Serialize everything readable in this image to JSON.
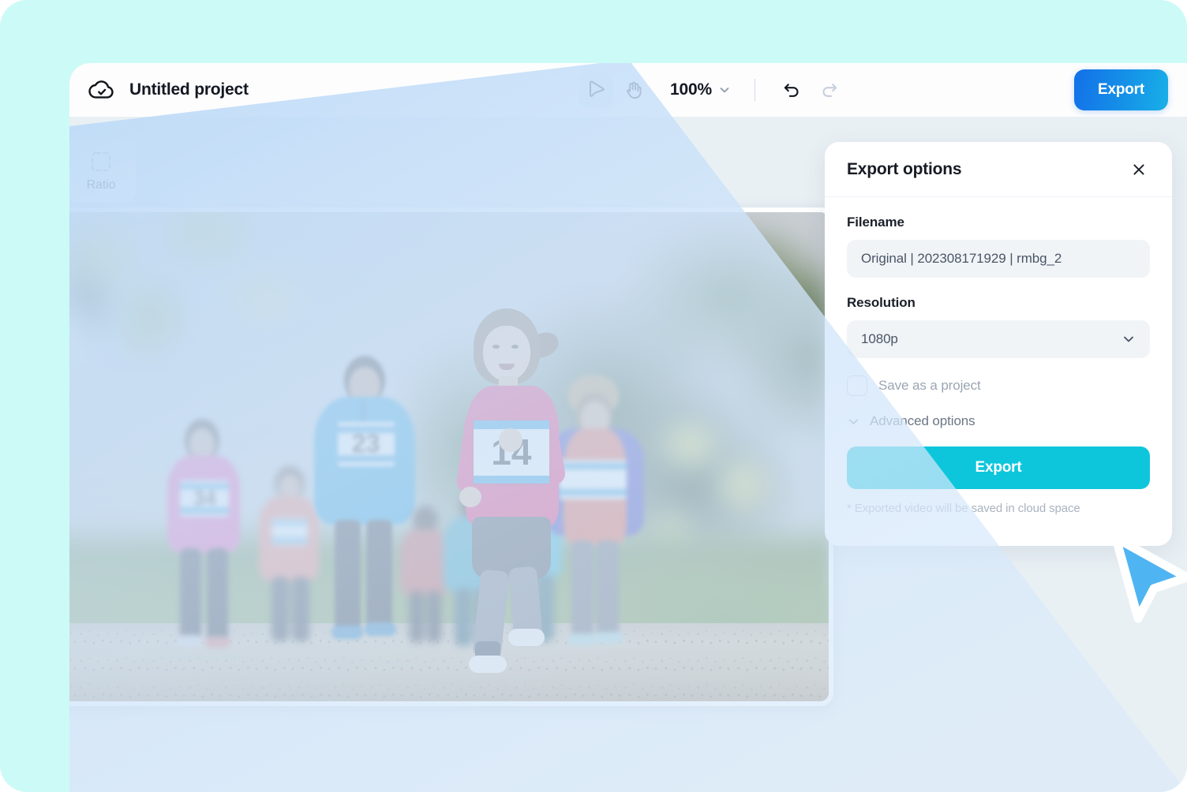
{
  "window": {
    "title": "Untitled project",
    "cloud_icon": "cloud-check-icon"
  },
  "toolbar": {
    "select_tool": "select-cursor-tool",
    "hand_tool": "hand-pan-tool",
    "zoom_level": "100%",
    "zoom_chevron": "chevron-down-icon",
    "undo": "undo-icon",
    "redo": "redo-icon",
    "export_label": "Export"
  },
  "left_tools": {
    "ratio": {
      "label": "Ratio",
      "icon": "dashed-square-icon"
    }
  },
  "canvas": {
    "photo_alt": "Children and adults running a cross-country race on a dirt path",
    "bib_numbers": {
      "main_runner": "14",
      "blue_jacket_runner": "23",
      "pink_shirt_runner": "34"
    }
  },
  "panel": {
    "title": "Export options",
    "close_icon": "close-x-icon",
    "filename": {
      "label": "Filename",
      "value": "Original | 202308171929 | rmbg_2"
    },
    "resolution": {
      "label": "Resolution",
      "value": "1080p",
      "chevron": "chevron-down-icon"
    },
    "save_as_project": {
      "label": "Save as a project",
      "checked": false
    },
    "advanced": {
      "label": "Advanced options",
      "chevron": "chevron-down-icon"
    },
    "export_button": "Export",
    "note": "* Exported video will be saved in cloud space"
  },
  "cursor": {
    "name": "pointer-cursor"
  },
  "colors": {
    "page_background": "#CCFAF7",
    "editor_background": "#E9F0F4",
    "topbar": "#FDFDFE",
    "export_top_gradient_start": "#1370E8",
    "export_top_gradient_end": "#18B0E8",
    "export_panel": "#0EC6DC",
    "cursor_fill": "#4FB5F2",
    "beam": "#CFE4FA"
  }
}
